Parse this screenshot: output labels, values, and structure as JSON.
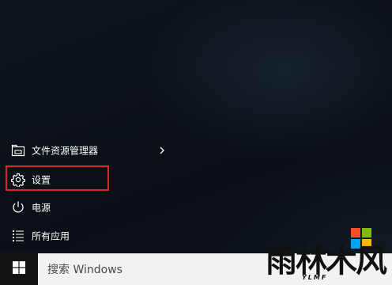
{
  "start_menu": {
    "items": [
      {
        "label": "文件资源管理器",
        "icon": "folder-explorer-icon",
        "has_submenu": true
      },
      {
        "label": "设置",
        "icon": "gear-icon",
        "highlighted": true
      },
      {
        "label": "电源",
        "icon": "power-icon"
      },
      {
        "label": "所有应用",
        "icon": "all-apps-icon"
      }
    ]
  },
  "taskbar": {
    "start_icon": "windows-logo-icon",
    "search_placeholder": "搜索 Windows"
  },
  "watermark": {
    "text": "雨林木风",
    "subtext": "YLMF",
    "logo": "microsoft-logo"
  },
  "colors": {
    "highlight_border": "#d6282d",
    "menu_text": "#ffffff",
    "search_bg": "#f2f2f2",
    "taskbar_bg": "#111315"
  }
}
